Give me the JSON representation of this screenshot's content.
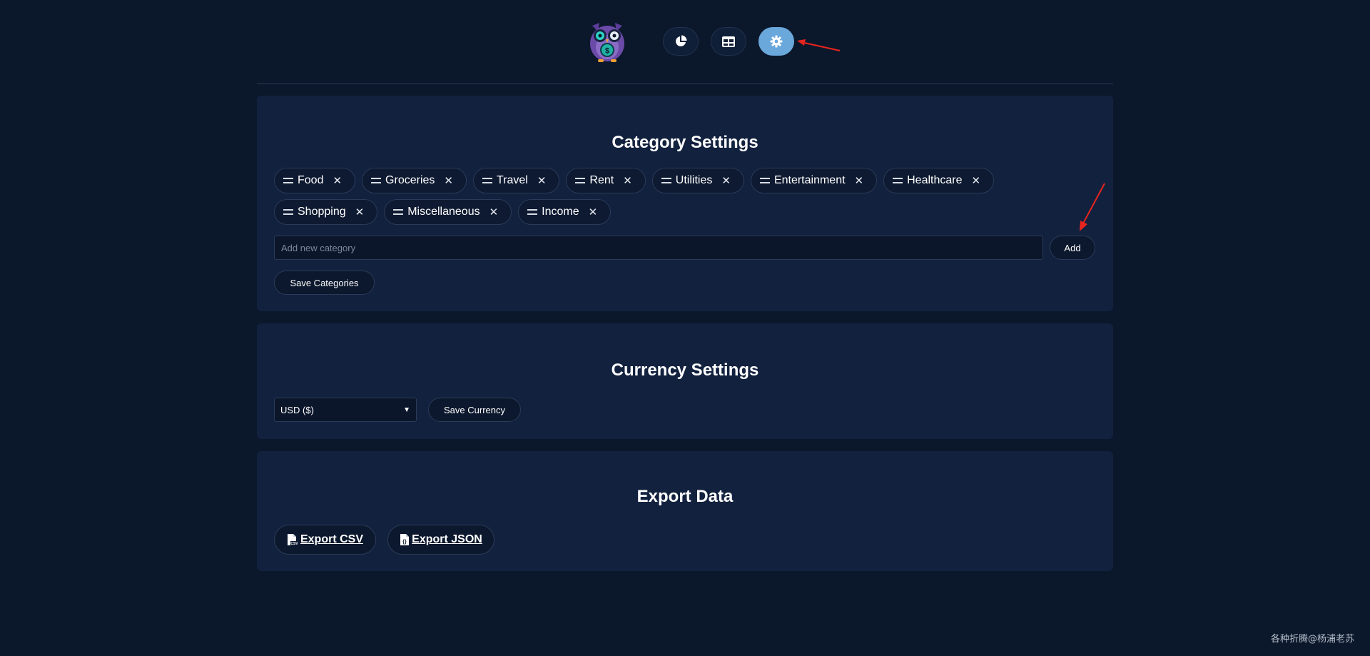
{
  "header": {
    "nav": [
      {
        "name": "chart-nav",
        "icon": "pie-chart-icon",
        "active": false
      },
      {
        "name": "table-nav",
        "icon": "table-icon",
        "active": false
      },
      {
        "name": "settings-nav",
        "icon": "gear-icon",
        "active": true
      }
    ]
  },
  "category_settings": {
    "title": "Category Settings",
    "categories": [
      "Food",
      "Groceries",
      "Travel",
      "Rent",
      "Utilities",
      "Entertainment",
      "Healthcare",
      "Shopping",
      "Miscellaneous",
      "Income"
    ],
    "input_placeholder": "Add new category",
    "add_label": "Add",
    "save_label": "Save Categories"
  },
  "currency_settings": {
    "title": "Currency Settings",
    "selected": "USD ($)",
    "save_label": "Save Currency"
  },
  "export": {
    "title": "Export Data",
    "csv_label": "Export CSV",
    "json_label": "Export JSON"
  },
  "watermark": "各种折腾@杨浦老苏",
  "colors": {
    "background": "#0b172b",
    "card": "#12213e",
    "active_nav": "#6aa8dc",
    "annotation_arrow": "#e8251f"
  }
}
